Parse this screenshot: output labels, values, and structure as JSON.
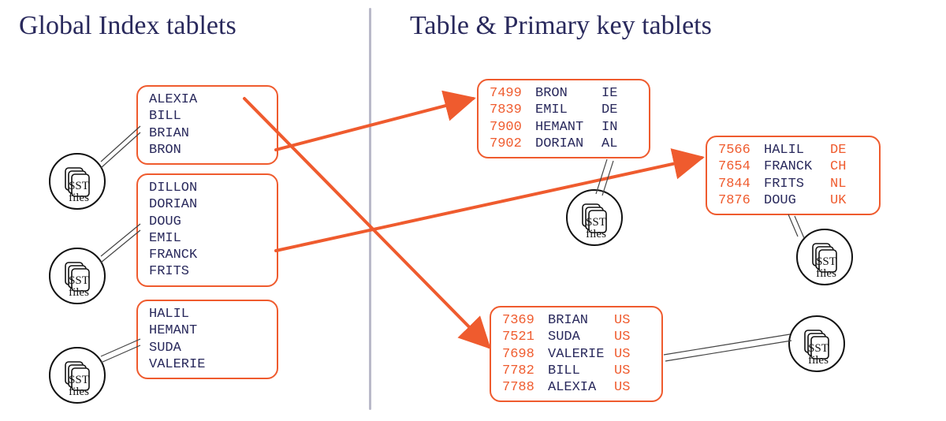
{
  "titles": {
    "left": "Global Index tablets",
    "right": "Table & Primary key tablets"
  },
  "sst_label": "SST\nfiles",
  "left_tablets": [
    {
      "names": [
        "ALEXIA",
        "BILL",
        "BRIAN",
        "BRON"
      ]
    },
    {
      "names": [
        "DILLON",
        "DORIAN",
        "DOUG",
        "EMIL",
        "FRANCK",
        "FRITS"
      ]
    },
    {
      "names": [
        "HALIL",
        "HEMANT",
        "SUDA",
        "VALERIE"
      ]
    }
  ],
  "right_tablets": [
    {
      "rows": [
        {
          "id": "7499",
          "name": "BRON",
          "cc": "IE"
        },
        {
          "id": "7839",
          "name": "EMIL",
          "cc": "DE"
        },
        {
          "id": "7900",
          "name": "HEMANT",
          "cc": "IN"
        },
        {
          "id": "7902",
          "name": "DORIAN",
          "cc": "AL"
        }
      ],
      "cc_orange": false
    },
    {
      "rows": [
        {
          "id": "7566",
          "name": "HALIL",
          "cc": "DE"
        },
        {
          "id": "7654",
          "name": "FRANCK",
          "cc": "CH"
        },
        {
          "id": "7844",
          "name": "FRITS",
          "cc": "NL"
        },
        {
          "id": "7876",
          "name": "DOUG",
          "cc": "UK"
        }
      ],
      "cc_orange": true
    },
    {
      "rows": [
        {
          "id": "7369",
          "name": "BRIAN",
          "cc": "US"
        },
        {
          "id": "7521",
          "name": "SUDA",
          "cc": "US"
        },
        {
          "id": "7698",
          "name": "VALERIE",
          "cc": "US"
        },
        {
          "id": "7782",
          "name": "BILL",
          "cc": "US"
        },
        {
          "id": "7788",
          "name": "ALEXIA",
          "cc": "US"
        }
      ],
      "cc_orange": true
    }
  ],
  "colors": {
    "ink": "#29295c",
    "orange": "#ef5b2e"
  }
}
